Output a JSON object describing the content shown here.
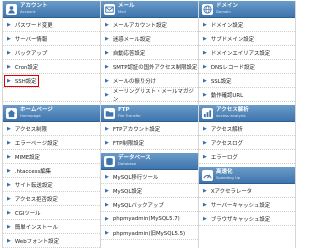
{
  "panels": [
    {
      "title": "アカウント",
      "subtitle": "Account",
      "icon": "user-icon",
      "items": [
        "パスワード変更",
        "サーバー情報",
        "バックアップ",
        "Cron設定",
        "SSH設定"
      ]
    },
    {
      "title": "メール",
      "subtitle": "Mail",
      "icon": "mail-icon",
      "items": [
        "メールアカウント設定",
        "迷惑メール設定",
        "自動応答設定",
        "SMTP認証の国外アクセス制限設定",
        "メールの振り分け",
        "メーリングリスト・メールマガジン"
      ]
    },
    {
      "title": "ドメイン",
      "subtitle": "Domain",
      "icon": "globe-icon",
      "items": [
        "ドメイン設定",
        "サブドメイン設定",
        "ドメインエイリアス設定",
        "DNSレコード設定",
        "SSL設定",
        "動作確認URL"
      ]
    },
    {
      "title": "ホームページ",
      "subtitle": "Homepage",
      "icon": "home-icon",
      "items": [
        "アクセス制限",
        "エラーページ設定",
        "MIME設定",
        ".htaccess編集",
        "サイト転送設定",
        "アクセス拒否設定",
        "CGIツール",
        "簡単インストール",
        "Webフォント設定"
      ]
    },
    {
      "title": "FTP",
      "subtitle": "File Transfer",
      "icon": "folder-icon",
      "items": [
        "FTPアカウント設定",
        "FTP制限設定"
      ]
    },
    {
      "title": "データベース",
      "subtitle": "Database",
      "icon": "database-icon",
      "items": [
        "MySQL移行ツール",
        "MySQL設定",
        "MySQLバックアップ",
        "phpmyadmin(MySQL5.7)",
        "phpmyadmin(旧MySQL5.5)"
      ]
    },
    {
      "title": "アクセス解析",
      "subtitle": "Access analysis",
      "icon": "chart-icon",
      "items": [
        "アクセス解析",
        "アクセスログ",
        "エラーログ"
      ]
    },
    {
      "title": "高速化",
      "subtitle": "Speeding Up",
      "icon": "speed-icon",
      "items": [
        "Xアクセラレータ",
        "サーバーキャッシュ設定",
        "ブラウザキャッシュ設定"
      ]
    }
  ],
  "highlighted_item": "SSH設定",
  "colors": {
    "header_top": "#6a9bc9",
    "header_bottom": "#3f75ad",
    "arrow": "#3a6ea8",
    "highlight": "#e00000"
  }
}
